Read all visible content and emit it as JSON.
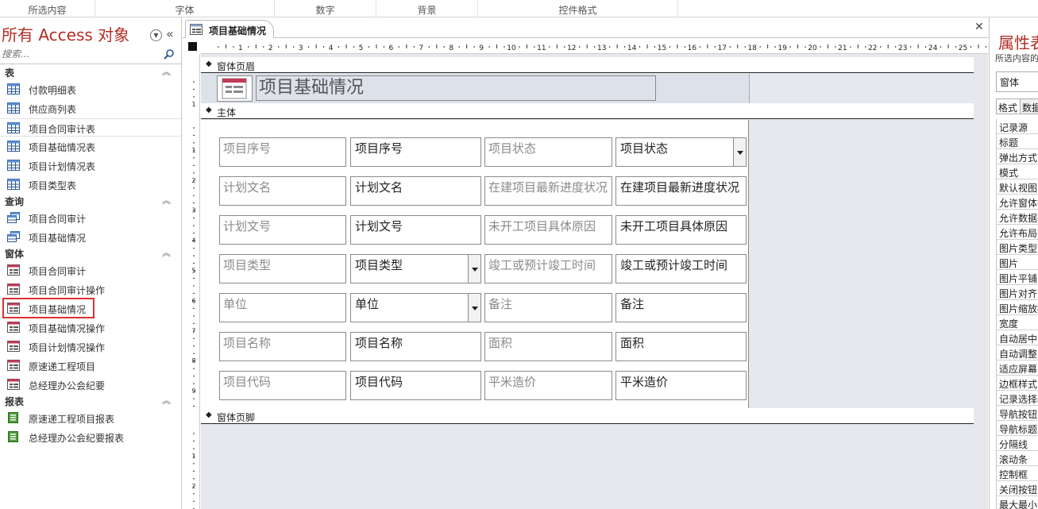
{
  "ribbon": {
    "groups": [
      "所选内容",
      "字体",
      "数字",
      "背景",
      "控件格式"
    ]
  },
  "nav": {
    "title": "所有 Access 对象",
    "menu_icon": "dropdown-circle-icon",
    "collapse_icon": "double-chevron-left-icon",
    "search_placeholder": "搜索...",
    "categories": [
      {
        "label": "表",
        "items": [
          "付款明细表",
          "供应商列表",
          "项目合同审计表",
          "项目基础情况表",
          "项目计划情况表",
          "项目类型表"
        ]
      },
      {
        "label": "查询",
        "items": [
          "项目合同审计",
          "项目基础情况"
        ]
      },
      {
        "label": "窗体",
        "items": [
          "项目合同审计",
          "项目合同审计操作",
          "项目基础情况",
          "项目基础情况操作",
          "项目计划情况操作",
          "原速递工程项目",
          "总经理办公会纪要"
        ]
      },
      {
        "label": "报表",
        "items": [
          "原速递工程项目报表",
          "总经理办公会纪要报表"
        ]
      }
    ]
  },
  "document": {
    "tab_label": "项目基础情况",
    "close_icon": "close-icon",
    "ruler_numbers": [
      "1",
      "2",
      "3",
      "4",
      "5",
      "6",
      "7",
      "8",
      "9",
      "10",
      "11",
      "12",
      "13",
      "14",
      "15",
      "16",
      "17",
      "18",
      "19",
      "20",
      "21",
      "22",
      "23",
      "24",
      "25"
    ],
    "vruler_top": [
      "1"
    ],
    "vruler_detail": [
      "1",
      "2",
      "3",
      "4",
      "5",
      "6",
      "7",
      "8",
      "9"
    ],
    "vruler_footer": [
      "1",
      "2"
    ],
    "sections": {
      "header": "窗体页眉",
      "detail": "主体",
      "footer": "窗体页脚"
    },
    "form_title": "项目基础情况",
    "rows": [
      {
        "label1": "项目序号",
        "field1": "项目序号",
        "combo1": false,
        "label2": "项目状态",
        "field2": "项目状态",
        "combo2": true
      },
      {
        "label1": "计划文名",
        "field1": "计划文名",
        "combo1": false,
        "label2": "在建项目最新进度状况",
        "field2": "在建项目最新进度状况",
        "combo2": false
      },
      {
        "label1": "计划文号",
        "field1": "计划文号",
        "combo1": false,
        "label2": "未开工项目具体原因",
        "field2": "未开工项目具体原因",
        "combo2": false
      },
      {
        "label1": "项目类型",
        "field1": "项目类型",
        "combo1": true,
        "label2": "竣工或预计竣工时间",
        "field2": "竣工或预计竣工时间",
        "combo2": false
      },
      {
        "label1": "单位",
        "field1": "单位",
        "combo1": true,
        "label2": "备注",
        "field2": "备注",
        "combo2": false
      },
      {
        "label1": "项目名称",
        "field1": "项目名称",
        "combo1": false,
        "label2": "面积",
        "field2": "面积",
        "combo2": false
      },
      {
        "label1": "项目代码",
        "field1": "项目代码",
        "combo1": false,
        "label2": "平米造价",
        "field2": "平米造价",
        "combo2": false
      }
    ]
  },
  "props": {
    "title": "属性表",
    "subtitle": "所选内容的类型: 窗体",
    "selected": "窗体",
    "tabs": [
      "格式",
      "数据"
    ],
    "rows": [
      "记录源",
      "标题",
      "弹出方式",
      "模式",
      "默认视图",
      "允许窗体视图",
      "允许数据表视图",
      "允许布局视图",
      "图片类型",
      "图片",
      "图片平铺",
      "图片对齐方式",
      "图片缩放模式",
      "宽度",
      "自动居中",
      "自动调整",
      "适应屏幕",
      "边框样式",
      "记录选择器",
      "导航按钮",
      "导航标题",
      "分隔线",
      "滚动条",
      "控制框",
      "关闭按钮",
      "最大最小化按钮"
    ]
  }
}
